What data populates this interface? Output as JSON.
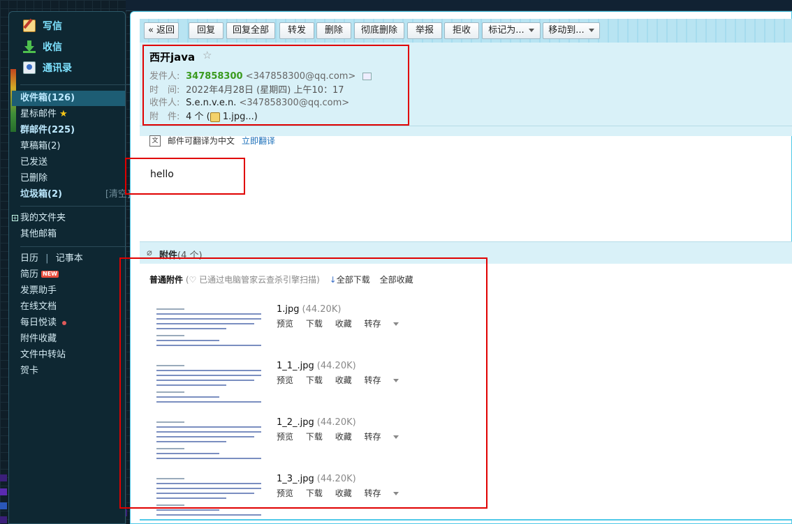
{
  "sidebar": {
    "write": "写信",
    "receive": "收信",
    "contacts": "通讯录",
    "folders": [
      {
        "label": "收件箱(126)"
      },
      {
        "label": "星标邮件"
      },
      {
        "label": "群邮件(225)"
      },
      {
        "label": "草稿箱(2)"
      },
      {
        "label": "已发送"
      },
      {
        "label": "已删除"
      },
      {
        "label": "垃圾箱(2)",
        "action": "[清空]"
      }
    ],
    "my_folders": "我的文件夹",
    "other_mail": "其他邮箱",
    "apps": {
      "calendar": "日历",
      "separator": "|",
      "notes": "记事本",
      "resume": "简历",
      "resume_badge": "NEW",
      "invoice": "发票助手",
      "docs": "在线文档",
      "daily": "每日悦读",
      "attachments": "附件收藏",
      "transfer": "文件中转站",
      "cards": "贺卡"
    }
  },
  "toolbar": {
    "back": "« 返回",
    "reply": "回复",
    "reply_all": "回复全部",
    "forward": "转发",
    "delete": "删除",
    "delete_perm": "彻底删除",
    "report": "举报",
    "reject": "拒收",
    "mark_as": "标记为...",
    "move_to": "移动到..."
  },
  "mail": {
    "subject": "西开java",
    "star": "☆",
    "from_label": "发件人:",
    "from_name": "347858300",
    "from_email": "<347858300@qq.com>",
    "time_label": "时　间:",
    "time": "2022年4月28日 (星期四) 上午10：17",
    "to_label": "收件人:",
    "to_name": "S.e.n.v.e.n.",
    "to_email": "<347858300@qq.com>",
    "att_label": "附　件:",
    "att_summary_pre": "4 个 (",
    "att_summary_post": " 1.jpg...)",
    "translate_text": "邮件可翻译为中文",
    "translate_link": "立即翻译",
    "body": "hello"
  },
  "attachments": {
    "clip_icon": "paperclip-icon",
    "title": "附件",
    "count": "(4 个)",
    "section_label": "普通附件",
    "scan_text": "已通过电脑管家云查杀引擎扫描",
    "scan_paren_open": "(",
    "scan_paren_close": ")",
    "download_all": "全部下载",
    "collect_all": "全部收藏",
    "actions": {
      "preview": "预览",
      "download": "下载",
      "collect": "收藏",
      "save_to": "转存"
    },
    "items": [
      {
        "name": "1.jpg",
        "size": "(44.20K)"
      },
      {
        "name": "1_1_.jpg",
        "size": "(44.20K)"
      },
      {
        "name": "1_2_.jpg",
        "size": "(44.20K)"
      },
      {
        "name": "1_3_.jpg",
        "size": "(44.20K)"
      }
    ]
  },
  "colors": {
    "accent": "#4fc9e8",
    "header_bg": "#d9f1f8",
    "sender_green": "#3a9a1e",
    "link_blue": "#1a6fb9",
    "annotation_red": "#e00000"
  }
}
